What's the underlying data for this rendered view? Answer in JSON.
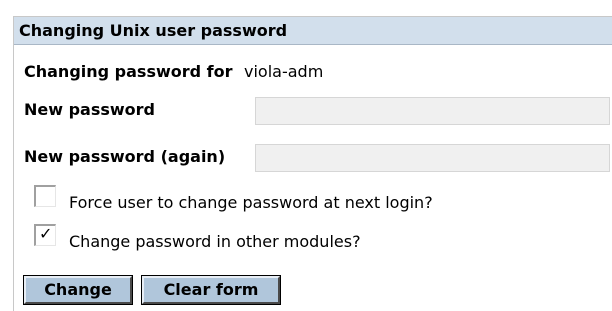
{
  "panel": {
    "title": "Changing Unix user password"
  },
  "form": {
    "changing_for_label": "Changing password for",
    "username": "viola-adm",
    "new_password": {
      "label": "New password",
      "value": ""
    },
    "new_password_again": {
      "label": "New password (again)",
      "value": ""
    },
    "force_change": {
      "label": "Force user to change password at next login?",
      "checked": false
    },
    "other_modules": {
      "label": "Change password in other modules?",
      "checked": true,
      "mark": "✓"
    }
  },
  "buttons": {
    "change_label": "Change",
    "clear_label": "Clear form"
  },
  "colors": {
    "header_bg": "#d2dfec",
    "button_bg": "#b0c6db",
    "input_bg": "#f0f0f0"
  }
}
